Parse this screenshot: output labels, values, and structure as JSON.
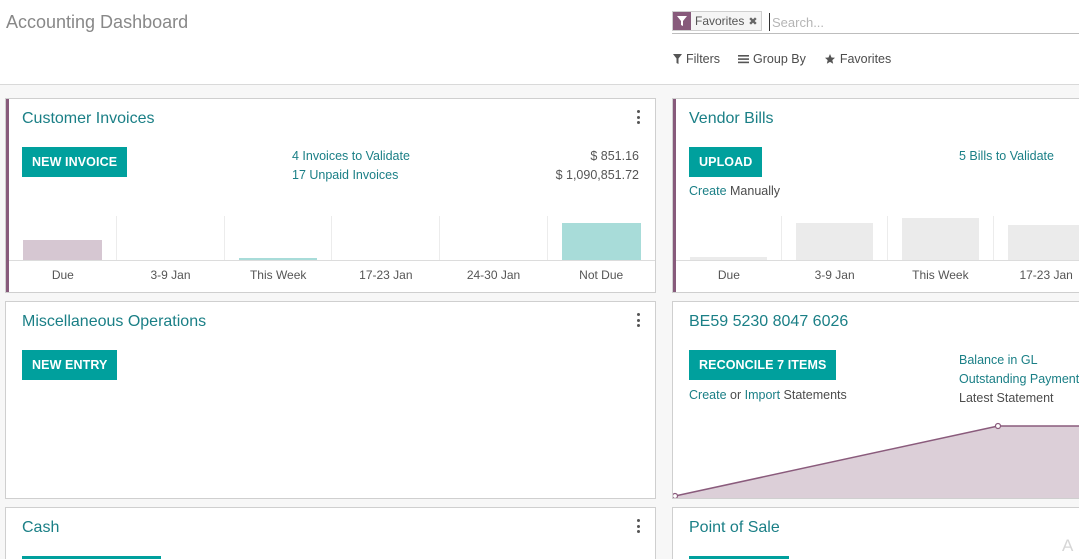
{
  "header": {
    "title": "Accounting Dashboard",
    "search": {
      "facet_label": "Favorites",
      "placeholder": "Search..."
    },
    "buttons": {
      "filters": "Filters",
      "group_by": "Group By",
      "favorites": "Favorites"
    }
  },
  "customer_invoices": {
    "title": "Customer Invoices",
    "new_button": "NEW INVOICE",
    "to_validate": "4 Invoices to Validate",
    "to_validate_amount": "$ 851.16",
    "unpaid": "17 Unpaid Invoices",
    "unpaid_amount": "$ 1,090,851.72",
    "graph": {
      "labels": [
        "Due",
        "3-9 Jan",
        "This Week",
        "17-23 Jan",
        "24-30 Jan",
        "Not Due"
      ],
      "values": [
        20,
        0,
        2,
        0,
        0,
        37
      ],
      "colors": [
        "#d6c7d2",
        "",
        "#a8dcd9",
        "",
        "",
        "#a8dcd9"
      ]
    }
  },
  "vendor_bills": {
    "title": "Vendor Bills",
    "upload_button": "UPLOAD",
    "to_validate": "5 Bills to Validate",
    "create_link": "Create",
    "create_suffix": "Manually",
    "graph": {
      "labels": [
        "Due",
        "3-9 Jan",
        "This Week",
        "17-23 Jan"
      ],
      "values": [
        3,
        37,
        42,
        35
      ],
      "color": "#ebebeb"
    }
  },
  "misc_operations": {
    "title": "Miscellaneous Operations",
    "new_button": "NEW ENTRY"
  },
  "bank": {
    "title": "BE59 5230 8047 6026",
    "reconcile_button": "RECONCILE 7 ITEMS",
    "create_link": "Create",
    "or_text": "or",
    "import_link": "Import",
    "statements_text": "Statements",
    "balance_gl": "Balance in GL",
    "outstanding": "Outstanding Payments",
    "latest_statement": "Latest Statement",
    "line_fill": "#dccfd8",
    "line_stroke": "#8a5b7c"
  },
  "cash": {
    "title": "Cash"
  },
  "point_of_sale": {
    "title": "Point of Sale"
  },
  "colors": {
    "accent": "#875a7b",
    "teal": "#00a09d",
    "link": "#1a7f86"
  }
}
